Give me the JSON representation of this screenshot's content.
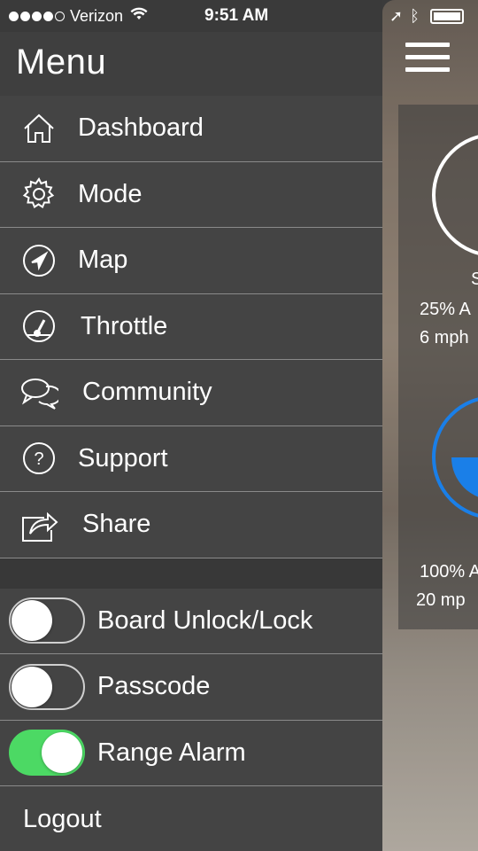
{
  "status_bar": {
    "carrier": "Verizon",
    "time": "9:51 AM",
    "signal_dots_filled": 4,
    "signal_dots_total": 5
  },
  "menu": {
    "title": "Menu",
    "items": [
      {
        "label": "Dashboard",
        "icon": "home-icon"
      },
      {
        "label": "Mode",
        "icon": "gear-icon"
      },
      {
        "label": "Map",
        "icon": "compass-icon"
      },
      {
        "label": "Throttle",
        "icon": "gauge-icon"
      },
      {
        "label": "Community",
        "icon": "chat-bubbles-icon"
      },
      {
        "label": "Support",
        "icon": "help-icon"
      },
      {
        "label": "Share",
        "icon": "share-icon"
      }
    ],
    "toggles": [
      {
        "label": "Board Unlock/Lock",
        "on": false
      },
      {
        "label": "Passcode",
        "on": false
      },
      {
        "label": "Range Alarm",
        "on": true
      }
    ],
    "logout": "Logout"
  },
  "background_app": {
    "text_1": "S",
    "text_2": "25% A",
    "text_3": "6 mph",
    "text_4": "100% A",
    "text_5": "20 mp"
  },
  "colors": {
    "drawer_bg": "#444444",
    "toggle_on": "#4cd964",
    "accent_blue": "#1a7fe8"
  }
}
